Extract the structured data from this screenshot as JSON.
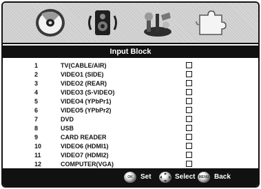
{
  "title": "Input Block",
  "menu_icons": [
    "disc-icon",
    "speaker-icon",
    "tools-icon",
    "puzzle-icon"
  ],
  "items": [
    {
      "num": "1",
      "name": "TV(CABLE/AIR)"
    },
    {
      "num": "2",
      "name": "VIDEO1 (SIDE)"
    },
    {
      "num": "3",
      "name": "VIDEO2 (REAR)"
    },
    {
      "num": "4",
      "name": "VIDEO3 (S-VIDEO)"
    },
    {
      "num": "5",
      "name": "VIDEO4 (YPbPr1)"
    },
    {
      "num": "6",
      "name": "VIDEO5 (YPbPr2)"
    },
    {
      "num": "7",
      "name": "DVD"
    },
    {
      "num": "8",
      "name": "USB"
    },
    {
      "num": "9",
      "name": "CARD READER"
    },
    {
      "num": "10",
      "name": "VIDEO6 (HDMI1)"
    },
    {
      "num": "11",
      "name": "VIDEO7 (HDMI2)"
    },
    {
      "num": "12",
      "name": "COMPUTER(VGA)"
    }
  ],
  "footer": {
    "set_button_text": "OK",
    "set_label": "Set",
    "select_label": "Select",
    "back_button_text": "MENU",
    "back_label": "Back"
  }
}
